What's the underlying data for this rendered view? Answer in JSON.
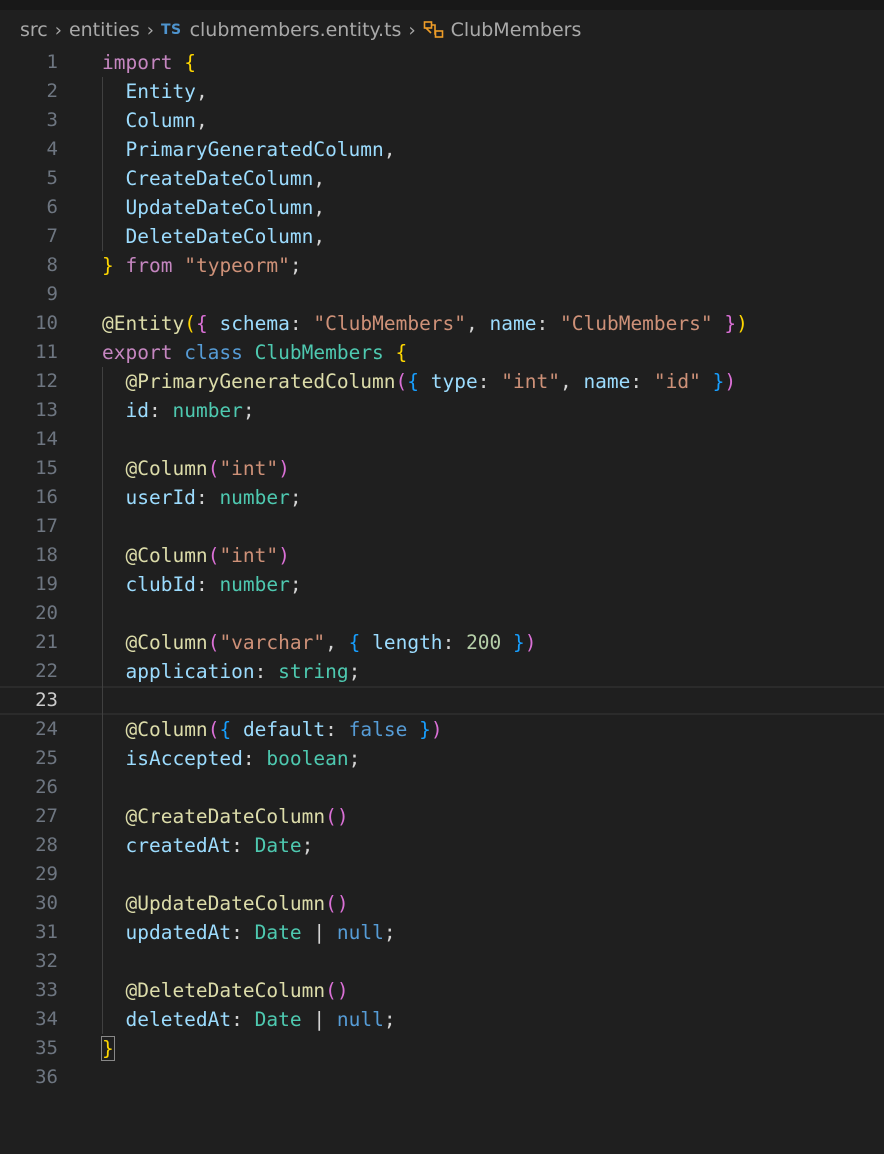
{
  "breadcrumb": {
    "items": [
      "src",
      "entities",
      "clubmembers.entity.ts",
      "ClubMembers"
    ],
    "file_badge": "TS",
    "icons": [
      "chevron-right-icon",
      "typescript-file-icon",
      "symbol-class-icon"
    ]
  },
  "colors": {
    "background": "#1f1f1f",
    "keyword": "#c586c0",
    "storage": "#569cd6",
    "function": "#dcdcaa",
    "string": "#ce9178",
    "number": "#b5cea8",
    "property": "#9cdcfe",
    "type": "#4ec9b0",
    "bracket_level_1": "#ffd700",
    "bracket_level_2": "#da70d6",
    "bracket_level_3": "#179fff",
    "line_number": "#6e7681"
  },
  "editor": {
    "current_line": 23,
    "lines": [
      [
        [
          "import",
          "kw"
        ],
        [
          " ",
          ""
        ],
        [
          "{",
          "b1"
        ]
      ],
      [
        [
          "  ",
          ""
        ],
        [
          "Entity",
          "prop"
        ],
        [
          ",",
          "punc"
        ]
      ],
      [
        [
          "  ",
          ""
        ],
        [
          "Column",
          "prop"
        ],
        [
          ",",
          "punc"
        ]
      ],
      [
        [
          "  ",
          ""
        ],
        [
          "PrimaryGeneratedColumn",
          "prop"
        ],
        [
          ",",
          "punc"
        ]
      ],
      [
        [
          "  ",
          ""
        ],
        [
          "CreateDateColumn",
          "prop"
        ],
        [
          ",",
          "punc"
        ]
      ],
      [
        [
          "  ",
          ""
        ],
        [
          "UpdateDateColumn",
          "prop"
        ],
        [
          ",",
          "punc"
        ]
      ],
      [
        [
          "  ",
          ""
        ],
        [
          "DeleteDateColumn",
          "prop"
        ],
        [
          ",",
          "punc"
        ]
      ],
      [
        [
          "}",
          "b1"
        ],
        [
          " ",
          ""
        ],
        [
          "from",
          "kw"
        ],
        [
          " ",
          ""
        ],
        [
          "\"typeorm\"",
          "str"
        ],
        [
          ";",
          "punc"
        ]
      ],
      [],
      [
        [
          "@",
          "fn"
        ],
        [
          "Entity",
          "fn"
        ],
        [
          "(",
          "b1"
        ],
        [
          "{",
          "b2"
        ],
        [
          " ",
          ""
        ],
        [
          "schema",
          "prop"
        ],
        [
          ":",
          "punc"
        ],
        [
          " ",
          ""
        ],
        [
          "\"ClubMembers\"",
          "str"
        ],
        [
          ",",
          "punc"
        ],
        [
          " ",
          ""
        ],
        [
          "name",
          "prop"
        ],
        [
          ":",
          "punc"
        ],
        [
          " ",
          ""
        ],
        [
          "\"ClubMembers\"",
          "str"
        ],
        [
          " ",
          ""
        ],
        [
          "}",
          "b2"
        ],
        [
          ")",
          "b1"
        ]
      ],
      [
        [
          "export",
          "kw"
        ],
        [
          " ",
          ""
        ],
        [
          "class",
          "blue"
        ],
        [
          " ",
          ""
        ],
        [
          "ClubMembers",
          "type"
        ],
        [
          " ",
          ""
        ],
        [
          "{",
          "b1"
        ]
      ],
      [
        [
          "  ",
          ""
        ],
        [
          "@",
          "fn"
        ],
        [
          "PrimaryGeneratedColumn",
          "fn"
        ],
        [
          "(",
          "b2"
        ],
        [
          "{",
          "b3"
        ],
        [
          " ",
          ""
        ],
        [
          "type",
          "prop"
        ],
        [
          ":",
          "punc"
        ],
        [
          " ",
          ""
        ],
        [
          "\"int\"",
          "str"
        ],
        [
          ",",
          "punc"
        ],
        [
          " ",
          ""
        ],
        [
          "name",
          "prop"
        ],
        [
          ":",
          "punc"
        ],
        [
          " ",
          ""
        ],
        [
          "\"id\"",
          "str"
        ],
        [
          " ",
          ""
        ],
        [
          "}",
          "b3"
        ],
        [
          ")",
          "b2"
        ]
      ],
      [
        [
          "  ",
          ""
        ],
        [
          "id",
          "prop"
        ],
        [
          ":",
          "punc"
        ],
        [
          " ",
          ""
        ],
        [
          "number",
          "type"
        ],
        [
          ";",
          "punc"
        ]
      ],
      [],
      [
        [
          "  ",
          ""
        ],
        [
          "@",
          "fn"
        ],
        [
          "Column",
          "fn"
        ],
        [
          "(",
          "b2"
        ],
        [
          "\"int\"",
          "str"
        ],
        [
          ")",
          "b2"
        ]
      ],
      [
        [
          "  ",
          ""
        ],
        [
          "userId",
          "prop"
        ],
        [
          ":",
          "punc"
        ],
        [
          " ",
          ""
        ],
        [
          "number",
          "type"
        ],
        [
          ";",
          "punc"
        ]
      ],
      [],
      [
        [
          "  ",
          ""
        ],
        [
          "@",
          "fn"
        ],
        [
          "Column",
          "fn"
        ],
        [
          "(",
          "b2"
        ],
        [
          "\"int\"",
          "str"
        ],
        [
          ")",
          "b2"
        ]
      ],
      [
        [
          "  ",
          ""
        ],
        [
          "clubId",
          "prop"
        ],
        [
          ":",
          "punc"
        ],
        [
          " ",
          ""
        ],
        [
          "number",
          "type"
        ],
        [
          ";",
          "punc"
        ]
      ],
      [],
      [
        [
          "  ",
          ""
        ],
        [
          "@",
          "fn"
        ],
        [
          "Column",
          "fn"
        ],
        [
          "(",
          "b2"
        ],
        [
          "\"varchar\"",
          "str"
        ],
        [
          ",",
          "punc"
        ],
        [
          " ",
          ""
        ],
        [
          "{",
          "b3"
        ],
        [
          " ",
          ""
        ],
        [
          "length",
          "prop"
        ],
        [
          ":",
          "punc"
        ],
        [
          " ",
          ""
        ],
        [
          "200",
          "num"
        ],
        [
          " ",
          ""
        ],
        [
          "}",
          "b3"
        ],
        [
          ")",
          "b2"
        ]
      ],
      [
        [
          "  ",
          ""
        ],
        [
          "application",
          "prop"
        ],
        [
          ":",
          "punc"
        ],
        [
          " ",
          ""
        ],
        [
          "string",
          "type"
        ],
        [
          ";",
          "punc"
        ]
      ],
      [],
      [
        [
          "  ",
          ""
        ],
        [
          "@",
          "fn"
        ],
        [
          "Column",
          "fn"
        ],
        [
          "(",
          "b2"
        ],
        [
          "{",
          "b3"
        ],
        [
          " ",
          ""
        ],
        [
          "default",
          "prop"
        ],
        [
          ":",
          "punc"
        ],
        [
          " ",
          ""
        ],
        [
          "false",
          "blue"
        ],
        [
          " ",
          ""
        ],
        [
          "}",
          "b3"
        ],
        [
          ")",
          "b2"
        ]
      ],
      [
        [
          "  ",
          ""
        ],
        [
          "isAccepted",
          "prop"
        ],
        [
          ":",
          "punc"
        ],
        [
          " ",
          ""
        ],
        [
          "boolean",
          "type"
        ],
        [
          ";",
          "punc"
        ]
      ],
      [],
      [
        [
          "  ",
          ""
        ],
        [
          "@",
          "fn"
        ],
        [
          "CreateDateColumn",
          "fn"
        ],
        [
          "()",
          "b2"
        ]
      ],
      [
        [
          "  ",
          ""
        ],
        [
          "createdAt",
          "prop"
        ],
        [
          ":",
          "punc"
        ],
        [
          " ",
          ""
        ],
        [
          "Date",
          "type"
        ],
        [
          ";",
          "punc"
        ]
      ],
      [],
      [
        [
          "  ",
          ""
        ],
        [
          "@",
          "fn"
        ],
        [
          "UpdateDateColumn",
          "fn"
        ],
        [
          "()",
          "b2"
        ]
      ],
      [
        [
          "  ",
          ""
        ],
        [
          "updatedAt",
          "prop"
        ],
        [
          ":",
          "punc"
        ],
        [
          " ",
          ""
        ],
        [
          "Date",
          "type"
        ],
        [
          " ",
          ""
        ],
        [
          "|",
          "punc"
        ],
        [
          " ",
          ""
        ],
        [
          "null",
          "blue"
        ],
        [
          ";",
          "punc"
        ]
      ],
      [],
      [
        [
          "  ",
          ""
        ],
        [
          "@",
          "fn"
        ],
        [
          "DeleteDateColumn",
          "fn"
        ],
        [
          "()",
          "b2"
        ]
      ],
      [
        [
          "  ",
          ""
        ],
        [
          "deletedAt",
          "prop"
        ],
        [
          ":",
          "punc"
        ],
        [
          " ",
          ""
        ],
        [
          "Date",
          "type"
        ],
        [
          " ",
          ""
        ],
        [
          "|",
          "punc"
        ],
        [
          " ",
          ""
        ],
        [
          "null",
          "blue"
        ],
        [
          ";",
          "punc"
        ]
      ],
      [
        [
          "}",
          "b1"
        ]
      ],
      []
    ]
  }
}
